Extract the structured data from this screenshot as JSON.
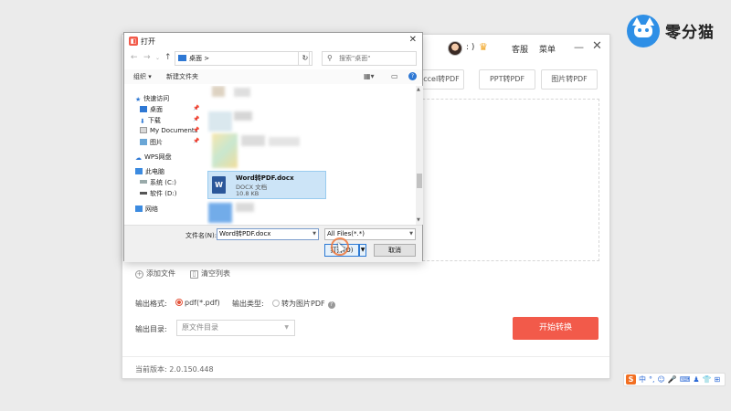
{
  "app": {
    "smiley": ": )",
    "links": [
      "客服",
      "菜单"
    ],
    "minimize_icon": "minimize-icon",
    "close_icon": "close-icon",
    "tabs": [
      "ccel转PDF",
      "PPT转PDF",
      "图片转PDF"
    ],
    "add_file": "添加文件",
    "clear_list": "清空列表",
    "output_format_label": "输出格式:",
    "output_format_value": "pdf(*.pdf)",
    "output_type_label": "输出类型:",
    "output_type_value": "转为图片PDF",
    "output_dir_label": "输出目录:",
    "output_dir_value": "原文件目录",
    "start_button": "开始转换",
    "version": "当前版本: 2.0.150.448",
    "accent_color": "#f25a4a"
  },
  "brand": {
    "name": "零分猫"
  },
  "dialog": {
    "title": "打开",
    "address": "桌面",
    "address_sep": ">",
    "search_placeholder": "搜索\"桌面\"",
    "toolbar": {
      "organize": "组织 ▾",
      "new_folder": "新建文件夹"
    },
    "tree": [
      {
        "label": "快速访问",
        "icon": "star-icon",
        "pinned": false
      },
      {
        "label": "桌面",
        "icon": "desktop-icon",
        "pinned": true
      },
      {
        "label": "下载",
        "icon": "download-icon",
        "pinned": true
      },
      {
        "label": "My Documents",
        "icon": "documents-icon",
        "pinned": true
      },
      {
        "label": "图片",
        "icon": "pictures-icon",
        "pinned": true
      },
      {
        "label": "WPS网盘",
        "icon": "cloud-icon",
        "pinned": false
      },
      {
        "label": "此电脑",
        "icon": "computer-icon",
        "pinned": false
      },
      {
        "label": "系统 (C:)",
        "icon": "drive-icon",
        "pinned": false
      },
      {
        "label": "软件 (D:)",
        "icon": "drive-icon",
        "pinned": false
      },
      {
        "label": "网络",
        "icon": "network-icon",
        "pinned": false
      }
    ],
    "selected_file": {
      "name": "Word转PDF.docx",
      "type": "DOCX 文档",
      "size": "10.8 KB"
    },
    "filename_label": "文件名(N):",
    "filename_value": "Word转PDF.docx",
    "filetype_value": "All Files(*.*)",
    "open_button": "打开(O)",
    "cancel_button": "取消"
  },
  "ime": {
    "items": [
      "中",
      "°,",
      "☺",
      "🎤",
      "⌨",
      "♟",
      "👕",
      "⊞"
    ]
  }
}
